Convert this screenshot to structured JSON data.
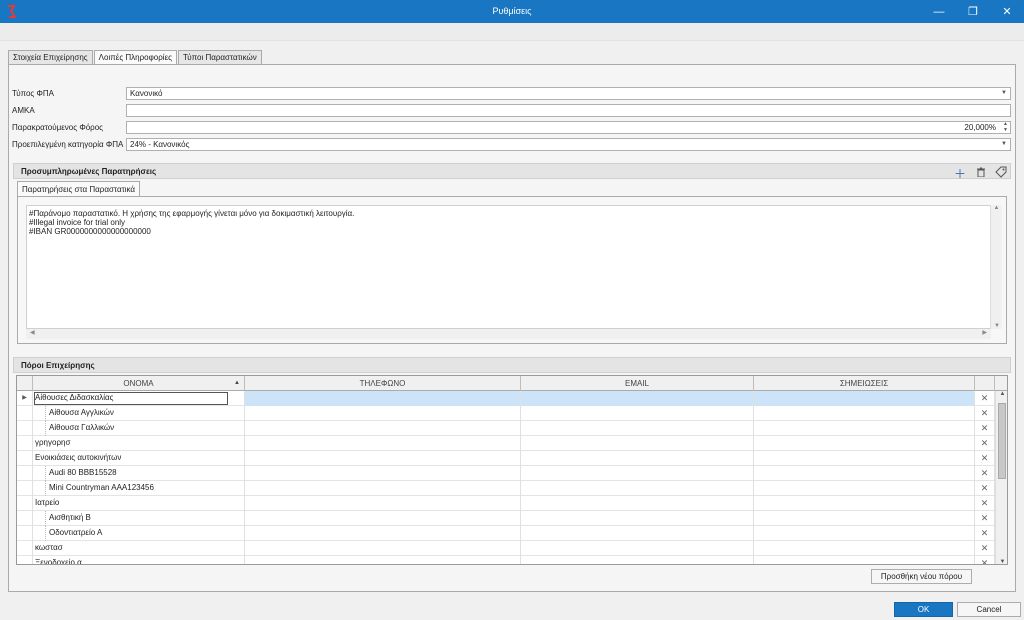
{
  "window": {
    "title": "Ρυθμίσεις",
    "minimize_glyph": "—",
    "restore_glyph": "❐",
    "close_glyph": "✕",
    "accent_color": "#1976c2"
  },
  "tabs": [
    {
      "label": "Στοιχεία Επιχείρησης",
      "active": false
    },
    {
      "label": "Λοιπές Πληροφορίες",
      "active": true
    },
    {
      "label": "Τύποι Παραστατικών",
      "active": false
    }
  ],
  "form": {
    "vat_type": {
      "label": "Τύπος ΦΠΑ",
      "value": "Κανονικό"
    },
    "amka": {
      "label": "ΑΜΚΑ",
      "value": ""
    },
    "withholding_tax": {
      "label": "Παρακρατούμενος Φόρος",
      "value": "20,000%"
    },
    "default_vat_category": {
      "label": "Προεπιλεγμένη κατηγορία ΦΠΑ",
      "value": "24% - Κανονικός"
    }
  },
  "predefined_notes": {
    "title": "Προσυμπληρωμένες Παρατηρήσεις",
    "icons": [
      "plus-icon",
      "trash-icon",
      "tag-icon"
    ],
    "tab_label": "Παρατηρήσεις στα Παραστατικά",
    "lines": [
      "#Παράνομο παραστατικό. Η χρήσης της εφαρμογής γίνεται μόνο για δοκιμαστική λειτουργία.",
      "#Illegal invoice for trial only",
      "#IBAN GR0000000000000000000"
    ]
  },
  "resources": {
    "title": "Πόροι Επιχείρησης",
    "columns": {
      "name": "ΟΝΟΜΑ",
      "phone": "ΤΗΛΕΦΩΝΟ",
      "email": "EMAIL",
      "notes": "ΣΗΜΕΙΩΣΕΙΣ"
    },
    "rows": [
      {
        "name": "Αίθουσες Διδασκαλίας",
        "level": 0,
        "selected": true
      },
      {
        "name": "Αίθουσα Αγγλικών",
        "level": 1,
        "selected": false
      },
      {
        "name": "Αίθουσα Γαλλικών",
        "level": 1,
        "selected": false
      },
      {
        "name": "γρηγορησ",
        "level": 0,
        "selected": false
      },
      {
        "name": "Ενοικιάσεις αυτοκινήτων",
        "level": 0,
        "selected": false
      },
      {
        "name": "Audi 80 BBB15528",
        "level": 1,
        "selected": false
      },
      {
        "name": "Mini Countryman AAA123456",
        "level": 1,
        "selected": false
      },
      {
        "name": "Ιατρείο",
        "level": 0,
        "selected": false
      },
      {
        "name": "Αισθητική Β",
        "level": 1,
        "selected": false
      },
      {
        "name": "Οδοντιατρείο Α",
        "level": 1,
        "selected": false
      },
      {
        "name": "κωστασ",
        "level": 0,
        "selected": false
      },
      {
        "name": "Ξενοδοχείο α",
        "level": 0,
        "selected": false
      }
    ],
    "add_button": "Προσθήκη νέου πόρου"
  },
  "footer": {
    "ok": "OK",
    "cancel": "Cancel"
  }
}
